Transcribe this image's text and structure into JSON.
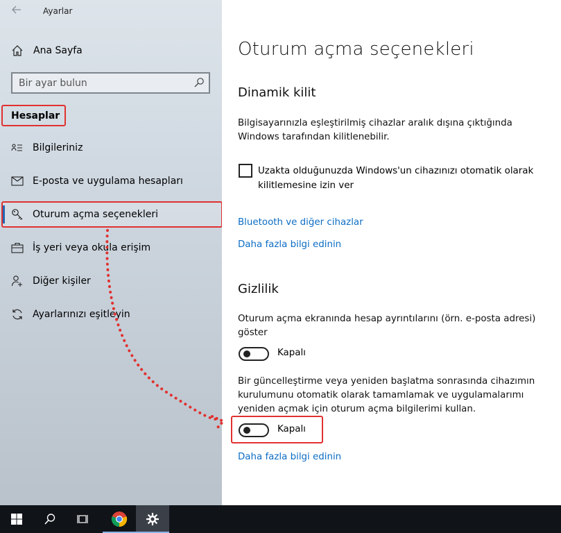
{
  "window": {
    "app_title": "Ayarlar"
  },
  "sidebar": {
    "home_label": "Ana Sayfa",
    "search_placeholder": "Bir ayar bulun",
    "section_title": "Hesaplar",
    "items": [
      {
        "label": "Bilgileriniz",
        "icon": "person-card-icon"
      },
      {
        "label": "E-posta ve uygulama hesapları",
        "icon": "mail-icon"
      },
      {
        "label": "Oturum açma seçenekleri",
        "icon": "key-icon",
        "active": true
      },
      {
        "label": "İş yeri veya okula erişim",
        "icon": "briefcase-icon"
      },
      {
        "label": "Diğer kişiler",
        "icon": "person-add-icon"
      },
      {
        "label": "Ayarlarınızı eşitleyin",
        "icon": "sync-icon"
      }
    ]
  },
  "main": {
    "page_title": "Oturum açma seçenekleri",
    "dynamic_lock": {
      "heading": "Dinamik kilit",
      "description": "Bilgisayarınızla eşleştirilmiş cihazlar aralık dışına çıktığında Windows tarafından kilitlenebilir.",
      "checkbox_label": "Uzakta olduğunuzda Windows'un cihazınızı otomatik olarak kilitlemesine izin ver",
      "checkbox_checked": false,
      "link_bluetooth": "Bluetooth ve diğer cihazlar",
      "link_more": "Daha fazla bilgi edinin"
    },
    "privacy": {
      "heading": "Gizlilik",
      "setting1_text": "Oturum açma ekranında hesap ayrıntılarını (örn. e-posta adresi) göster",
      "setting1_state": "Kapalı",
      "setting2_text": "Bir güncelleştirme veya yeniden başlatma sonrasında cihazımın kurulumunu otomatik olarak tamamlamak ve uygulamalarımı yeniden açmak için oturum açma bilgilerimi kullan.",
      "setting2_state": "Kapalı",
      "link_more": "Daha fazla bilgi edinin"
    }
  },
  "taskbar": {
    "items": [
      "start-icon",
      "search-icon",
      "task-view-icon",
      "chrome-icon",
      "settings-gear-icon"
    ]
  },
  "colors": {
    "accent": "#0b6cc4",
    "highlight": "#e0312f",
    "taskbar": "#101318"
  }
}
